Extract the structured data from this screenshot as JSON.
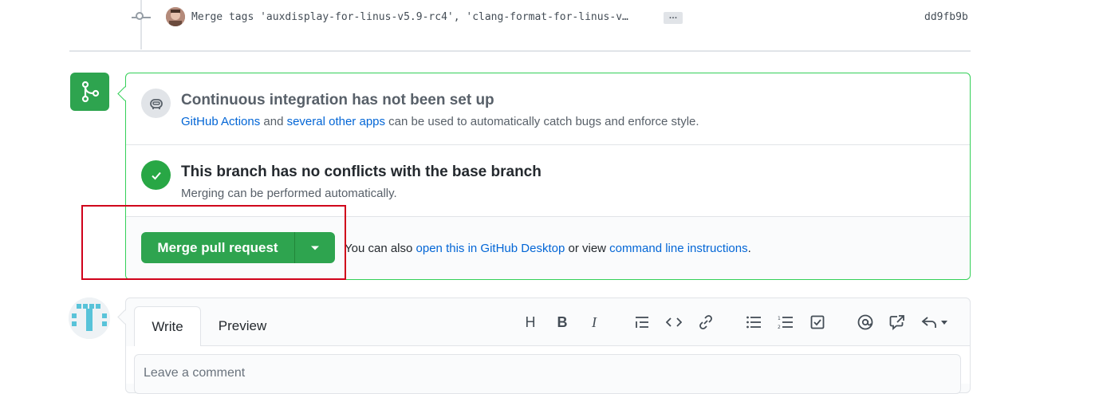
{
  "commit": {
    "message": "Merge tags 'auxdisplay-for-linus-v5.9-rc4', 'clang-format-for-linus-v…",
    "ellipsis": "…",
    "sha": "dd9fb9b"
  },
  "ci": {
    "title": "Continuous integration has not been set up",
    "link1": "GitHub Actions",
    "text1": " and ",
    "link2": "several other apps",
    "text2": " can be used to automatically catch bugs and enforce style."
  },
  "conflicts": {
    "title": "This branch has no conflicts with the base branch",
    "desc": "Merging can be performed automatically."
  },
  "merge": {
    "button_label": "Merge pull request",
    "text1": "You can also ",
    "link1": "open this in GitHub Desktop",
    "text2": " or view ",
    "link2": "command line instructions",
    "text3": "."
  },
  "comment": {
    "tab_write": "Write",
    "tab_preview": "Preview",
    "placeholder": "Leave a comment",
    "toolbar": {
      "heading": "H",
      "bold": "B",
      "italic": "I"
    }
  },
  "colors": {
    "accent_green": "#2ea44f",
    "link_blue": "#0366d6",
    "highlight_red": "#d0021b"
  },
  "icons": [
    "commit-node-icon",
    "git-merge-icon",
    "robot-icon",
    "check-icon",
    "triangle-down-icon",
    "quote-icon",
    "code-icon",
    "link-icon",
    "unordered-list-icon",
    "ordered-list-icon",
    "tasklist-icon",
    "mention-icon",
    "cross-reference-icon",
    "reply-icon"
  ]
}
